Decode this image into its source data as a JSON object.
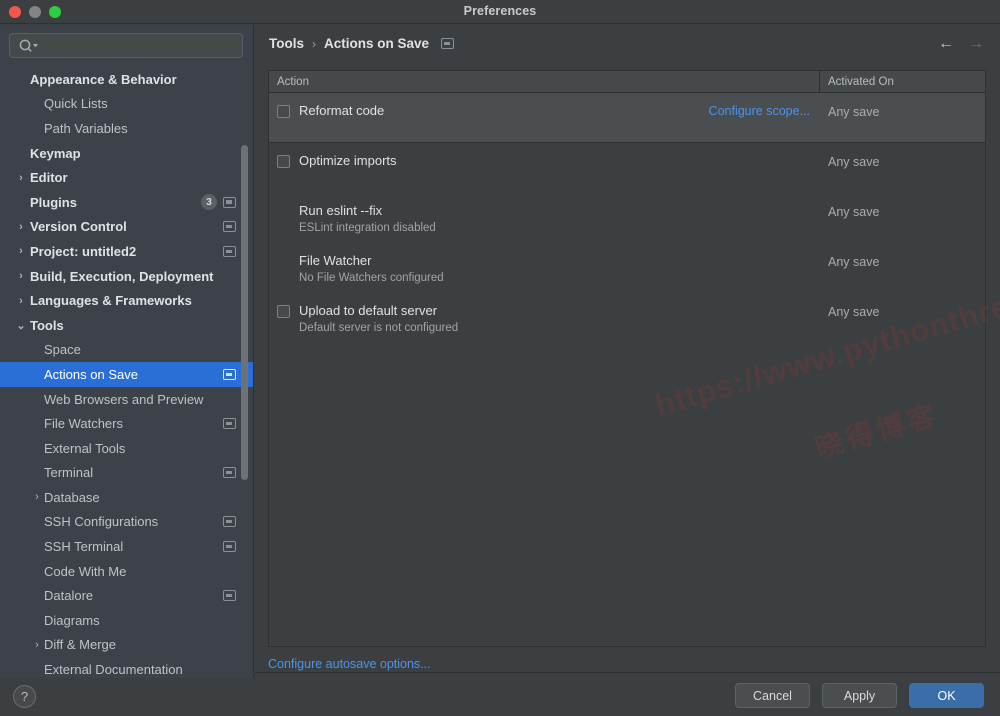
{
  "window": {
    "title": "Preferences",
    "traffic_lights": [
      "close-red",
      "minimize-grey",
      "zoom-green"
    ]
  },
  "sidebar": {
    "search": {
      "value": "",
      "placeholder": ""
    },
    "items": [
      {
        "label": "Appearance & Behavior",
        "level": 0,
        "bold": true,
        "arrow": "",
        "badge": null,
        "window_icon": false,
        "selected": false
      },
      {
        "label": "Quick Lists",
        "level": 1,
        "bold": false,
        "arrow": "",
        "badge": null,
        "window_icon": false,
        "selected": false
      },
      {
        "label": "Path Variables",
        "level": 1,
        "bold": false,
        "arrow": "",
        "badge": null,
        "window_icon": false,
        "selected": false
      },
      {
        "label": "Keymap",
        "level": 0,
        "bold": true,
        "arrow": "",
        "badge": null,
        "window_icon": false,
        "selected": false
      },
      {
        "label": "Editor",
        "level": 0,
        "bold": true,
        "arrow": "›",
        "badge": null,
        "window_icon": false,
        "selected": false
      },
      {
        "label": "Plugins",
        "level": 0,
        "bold": true,
        "arrow": "",
        "badge": "3",
        "window_icon": true,
        "selected": false
      },
      {
        "label": "Version Control",
        "level": 0,
        "bold": true,
        "arrow": "›",
        "badge": null,
        "window_icon": true,
        "selected": false
      },
      {
        "label": "Project: untitled2",
        "level": 0,
        "bold": true,
        "arrow": "›",
        "badge": null,
        "window_icon": true,
        "selected": false
      },
      {
        "label": "Build, Execution, Deployment",
        "level": 0,
        "bold": true,
        "arrow": "›",
        "badge": null,
        "window_icon": false,
        "selected": false
      },
      {
        "label": "Languages & Frameworks",
        "level": 0,
        "bold": true,
        "arrow": "›",
        "badge": null,
        "window_icon": false,
        "selected": false
      },
      {
        "label": "Tools",
        "level": 0,
        "bold": true,
        "arrow": "⌄",
        "badge": null,
        "window_icon": false,
        "selected": false
      },
      {
        "label": "Space",
        "level": 1,
        "bold": false,
        "arrow": "",
        "badge": null,
        "window_icon": false,
        "selected": false
      },
      {
        "label": "Actions on Save",
        "level": 1,
        "bold": false,
        "arrow": "",
        "badge": null,
        "window_icon": true,
        "selected": true
      },
      {
        "label": "Web Browsers and Preview",
        "level": 1,
        "bold": false,
        "arrow": "",
        "badge": null,
        "window_icon": false,
        "selected": false
      },
      {
        "label": "File Watchers",
        "level": 1,
        "bold": false,
        "arrow": "",
        "badge": null,
        "window_icon": true,
        "selected": false
      },
      {
        "label": "External Tools",
        "level": 1,
        "bold": false,
        "arrow": "",
        "badge": null,
        "window_icon": false,
        "selected": false
      },
      {
        "label": "Terminal",
        "level": 1,
        "bold": false,
        "arrow": "",
        "badge": null,
        "window_icon": true,
        "selected": false
      },
      {
        "label": "Database",
        "level": 1,
        "bold": false,
        "arrow": "›",
        "badge": null,
        "window_icon": false,
        "selected": false
      },
      {
        "label": "SSH Configurations",
        "level": 1,
        "bold": false,
        "arrow": "",
        "badge": null,
        "window_icon": true,
        "selected": false
      },
      {
        "label": "SSH Terminal",
        "level": 1,
        "bold": false,
        "arrow": "",
        "badge": null,
        "window_icon": true,
        "selected": false
      },
      {
        "label": "Code With Me",
        "level": 1,
        "bold": false,
        "arrow": "",
        "badge": null,
        "window_icon": false,
        "selected": false
      },
      {
        "label": "Datalore",
        "level": 1,
        "bold": false,
        "arrow": "",
        "badge": null,
        "window_icon": true,
        "selected": false
      },
      {
        "label": "Diagrams",
        "level": 1,
        "bold": false,
        "arrow": "",
        "badge": null,
        "window_icon": false,
        "selected": false
      },
      {
        "label": "Diff & Merge",
        "level": 1,
        "bold": false,
        "arrow": "›",
        "badge": null,
        "window_icon": false,
        "selected": false
      },
      {
        "label": "External Documentation",
        "level": 1,
        "bold": false,
        "arrow": "",
        "badge": null,
        "window_icon": false,
        "selected": false
      }
    ],
    "help_label": "?"
  },
  "main": {
    "breadcrumb": {
      "parent": "Tools",
      "separator": "›",
      "current": "Actions on Save"
    },
    "nav": {
      "back": "←",
      "forward": "→"
    },
    "table": {
      "columns": [
        "Action",
        "Activated On"
      ],
      "rows": [
        {
          "checkbox": true,
          "title": "Reformat code",
          "subtitle": "",
          "link": "Configure scope...",
          "activated": "Any save",
          "highlighted": true
        },
        {
          "checkbox": true,
          "title": "Optimize imports",
          "subtitle": "",
          "link": "",
          "activated": "Any save",
          "highlighted": false
        },
        {
          "checkbox": false,
          "title": "Run eslint --fix",
          "subtitle": "ESLint integration disabled",
          "link": "",
          "activated": "Any save",
          "highlighted": false
        },
        {
          "checkbox": false,
          "title": "File Watcher",
          "subtitle": "No File Watchers configured",
          "link": "",
          "activated": "Any save",
          "highlighted": false
        },
        {
          "checkbox": true,
          "title": "Upload to default server",
          "subtitle": "Default server is not configured",
          "link": "",
          "activated": "Any save",
          "highlighted": false
        }
      ]
    },
    "autosave_link": "Configure autosave options..."
  },
  "footer": {
    "cancel": "Cancel",
    "apply": "Apply",
    "ok": "OK"
  },
  "watermark": {
    "line1": "https://www.pythonthree.com",
    "line2": "晓得博客"
  },
  "colors": {
    "accent_blue": "#2a6fd6",
    "link_blue": "#4d93e8",
    "ok_button": "#3b6ea8",
    "sidebar_bg": "#3c414a",
    "panel_bg": "#3c3f41"
  }
}
